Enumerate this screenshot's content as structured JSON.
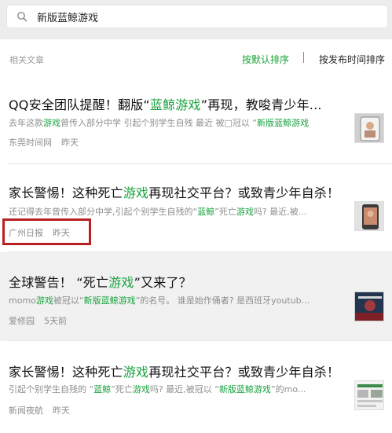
{
  "search": {
    "query": "新版蓝鲸游戏"
  },
  "section_label": "相关文章",
  "sort": {
    "default": "按默认排序",
    "by_time": "按发布时间排序"
  },
  "results": [
    {
      "title": [
        "QQ安全团队提醒！翻版“",
        "蓝鲸游戏",
        "”再现，教唆青少年..."
      ],
      "snippet": [
        "去年这款",
        "游戏",
        "曾传入部分中学 引起个别学生自残 最近 被□冠以 “",
        "新版蓝鲸游戏",
        ""
      ],
      "source": "东莞时间网",
      "date": "昨天"
    },
    {
      "title": [
        "家长警惕！这种死亡",
        "游戏",
        "再现社交平台？或致青少年自杀！"
      ],
      "snippet": [
        "还记得去年曾传入部分中学,引起个别学生自残的“",
        "蓝鲸",
        "”死亡",
        "游戏",
        "吗? 最近,被..."
      ],
      "source": "广州日报",
      "date": "昨天"
    },
    {
      "title": [
        "全球警告！ “死亡",
        "游戏",
        "”又来了？"
      ],
      "snippet": [
        "momo",
        "游戏",
        "被冠以“",
        "新版蓝鲸游戏",
        "”的名号。 谁是始作俑者? 是西班牙youtub..."
      ],
      "source": "爱修园",
      "date": "5天前"
    },
    {
      "title": [
        "家长警惕！这种死亡",
        "游戏",
        "再现社交平台？或致青少年自杀！"
      ],
      "snippet": [
        "引起个别学生自残的 “",
        "蓝鲸",
        "”死亡",
        "游戏",
        "吗? 最近,被冠以 “",
        "新版蓝鲸游戏",
        "”的mo..."
      ],
      "source": "新闻夜航",
      "date": "昨天"
    }
  ]
}
